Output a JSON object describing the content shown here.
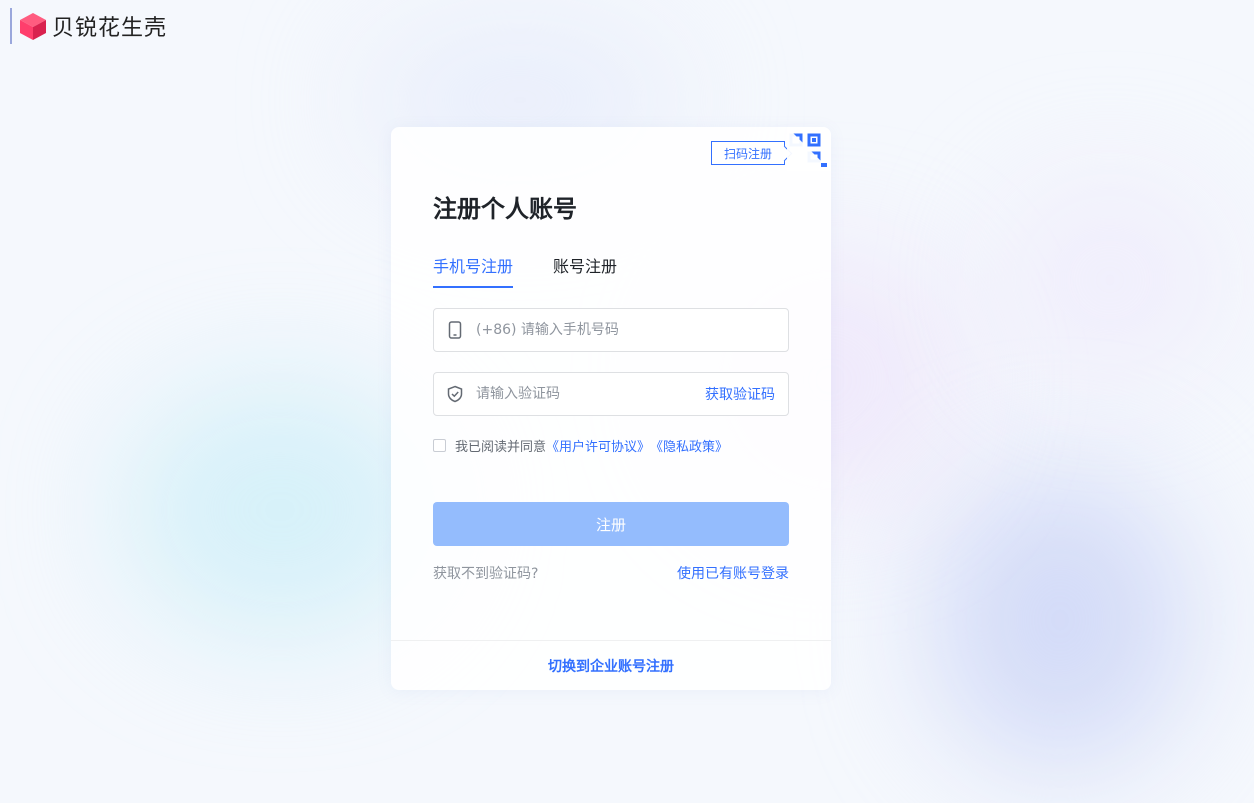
{
  "brand": {
    "name": "贝锐花生壳",
    "colors": {
      "cube_pink": "#ff3e6c",
      "cube_dark": "#d9224f",
      "accent": "#3370ff"
    }
  },
  "card": {
    "qr_tip": "扫码注册",
    "title": "注册个人账号",
    "tabs": [
      {
        "label": "手机号注册",
        "active": true
      },
      {
        "label": "账号注册",
        "active": false
      }
    ],
    "phone_field": {
      "placeholder": "(+86) 请输入手机号码",
      "icon": "mobile-phone-icon"
    },
    "code_field": {
      "placeholder": "请输入验证码",
      "icon": "shield-check-icon",
      "action": "获取验证码"
    },
    "agreement": {
      "text": "我已阅读并同意",
      "user_license": "《用户许可协议》",
      "privacy": "《隐私政策》",
      "checked": false
    },
    "submit_label": "注册",
    "no_code_text": "获取不到验证码?",
    "login_link": "使用已有账号登录",
    "switch_link": "切换到企业账号注册"
  }
}
